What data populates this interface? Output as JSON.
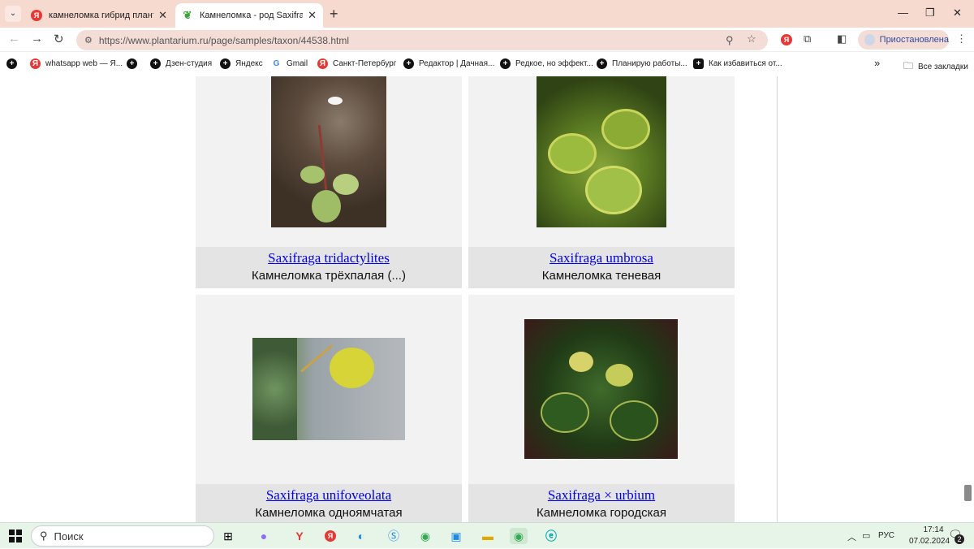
{
  "tabs": [
    {
      "title": "камнеломка гибрид плантари",
      "favicon": "yandex-icon"
    },
    {
      "title": "Камнеломка - род Saxifraga - П",
      "favicon": "leaf-icon"
    }
  ],
  "address": {
    "url": "https://www.plantarium.ru/page/samples/taxon/44538.html"
  },
  "profile": {
    "label": "Приостановлена"
  },
  "bookmarks": [
    {
      "label": "whatsapp web — Я...",
      "icon": "yandex"
    },
    {
      "label": "",
      "icon": "plus"
    },
    {
      "label": "Дзен-студия",
      "icon": "plus"
    },
    {
      "label": "Яндекс",
      "icon": "plus"
    },
    {
      "label": "Gmail",
      "icon": "google"
    },
    {
      "label": "Санкт-Петербург",
      "icon": "yandex"
    },
    {
      "label": "Редактор | Дачная...",
      "icon": "plus"
    },
    {
      "label": "Редкое, но эффект...",
      "icon": "plus"
    },
    {
      "label": "Планирую работы...",
      "icon": "plus"
    },
    {
      "label": "Как избавиться от...",
      "icon": "square"
    }
  ],
  "bookmarks_overflow": "»",
  "all_bookmarks": "Все закладки",
  "cards": [
    {
      "latin": "Saxifraga tridactylites",
      "russian": "Камнеломка трёхпалая (...)"
    },
    {
      "latin": "Saxifraga umbrosa",
      "russian": "Камнеломка теневая"
    },
    {
      "latin": "Saxifraga unifoveolata",
      "russian": "Камнеломка одноямчатая"
    },
    {
      "latin": "Saxifraga × urbium",
      "russian": "Камнеломка городская"
    }
  ],
  "taskbar": {
    "search_label": "Поиск",
    "lang": "РУС",
    "time": "17:14",
    "date": "07.02.2024",
    "notif_count": "2"
  }
}
